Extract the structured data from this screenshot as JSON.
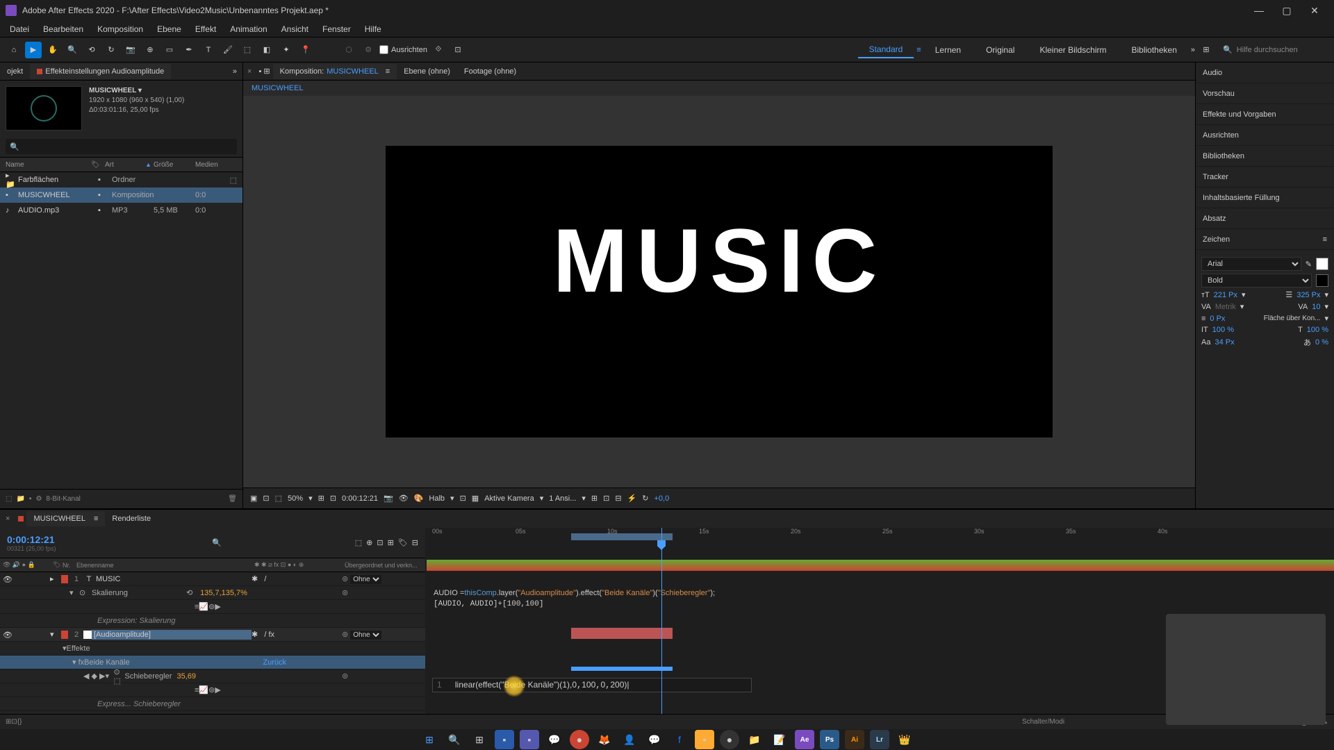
{
  "window": {
    "title": "Adobe After Effects 2020 - F:\\After Effects\\Video2Music\\Unbenanntes Projekt.aep *"
  },
  "menu": [
    "Datei",
    "Bearbeiten",
    "Komposition",
    "Ebene",
    "Effekt",
    "Animation",
    "Ansicht",
    "Fenster",
    "Hilfe"
  ],
  "toolbar": {
    "ausrichten": "Ausrichten",
    "workspaces": [
      "Standard",
      "Lernen",
      "Original",
      "Kleiner Bildschirm",
      "Bibliotheken"
    ],
    "search_placeholder": "Hilfe durchsuchen"
  },
  "project_panel": {
    "tab_projekt": "ojekt",
    "tab_effekt": "Effekteinstellungen Audioamplitude",
    "comp_name": "MUSICWHEEL ▾",
    "resolution": "1920 x 1080 (960 x 540) (1,00)",
    "duration": "Δ0:03:01:16, 25,00 fps",
    "cols": {
      "name": "Name",
      "art": "Art",
      "groesse": "Größe",
      "medien": "Medien"
    },
    "items": [
      {
        "icon": "▸ 📁",
        "name": "Farbflächen",
        "art": "Ordner",
        "size": "",
        "extra": ""
      },
      {
        "icon": "▪",
        "name": "MUSICWHEEL",
        "art": "Komposition",
        "size": "",
        "extra": "0:0",
        "selected": true
      },
      {
        "icon": "♪",
        "name": "AUDIO.mp3",
        "art": "MP3",
        "size": "5,5 MB",
        "extra": "0:0"
      }
    ],
    "footer": "8-Bit-Kanal"
  },
  "composition": {
    "tab_label": "Komposition:",
    "tab_name": "MUSICWHEEL",
    "tab_ebene": "Ebene (ohne)",
    "tab_footage": "Footage (ohne)",
    "crumb": "MUSICWHEEL",
    "content_text": "MUSIC",
    "zoom": "50%",
    "timecode": "0:00:12:21",
    "res": "Halb",
    "camera": "Aktive Kamera",
    "views": "1 Ansi...",
    "exposure": "+0,0"
  },
  "right_panels": [
    "Audio",
    "Vorschau",
    "Effekte und Vorgaben",
    "Ausrichten",
    "Bibliotheken",
    "Tracker",
    "Inhaltsbasierte Füllung",
    "Absatz",
    "Zeichen"
  ],
  "character": {
    "font": "Arial",
    "weight": "Bold",
    "size": "221 Px",
    "leading": "325 Px",
    "kerning": "Metrik",
    "tracking": "10",
    "stroke": "0 Px",
    "stroke_mode": "Fläche über Kon...",
    "vscale": "100 %",
    "hscale": "100 %",
    "baseline": "34 Px",
    "tsume": "0 %"
  },
  "timeline": {
    "tab": "MUSICWHEEL",
    "tab2": "Renderliste",
    "timecode": "0:00:12:21",
    "timecode_sub": "00321 (25,00 fps)",
    "col_nr": "Nr.",
    "col_name": "Ebenenname",
    "col_parent": "Übergeordnet und verkn...",
    "parent_none": "Ohne",
    "ticks": [
      "00s",
      "05s",
      "10s",
      "15s",
      "20s",
      "25s",
      "30s",
      "35s",
      "40s"
    ],
    "layers": {
      "l1_num": "1",
      "l1_name": "MUSIC",
      "l1_scale": "Skalierung",
      "l1_scale_val": "135,7,135,7%",
      "l1_expr_label": "Expression: Skalierung",
      "l2_num": "2",
      "l2_name": "[Audioamplitude]",
      "l2_effekte": "Effekte",
      "l2_both": "Beide Kanäle",
      "l2_zuruck": "Zurück",
      "l2_slider": "Schieberegler",
      "l2_slider_val": "35,69",
      "l2_expr_label": "Express... Schieberegler"
    },
    "expr1": {
      "prefix": "AUDIO =",
      "this": "thisComp",
      "layer": ".layer(",
      "layer_str": "\"Audioamplitude\"",
      "effect": ").effect(",
      "effect_str": "\"Beide Kanäle\"",
      "slider": ")(",
      "slider_str": "\"Schieberegler\"",
      "end": ");",
      "line2": "[AUDIO, AUDIO]+[100,100]"
    },
    "expr2": {
      "line_num": "1",
      "fn": "linear",
      "open": "(",
      "eff": "effect",
      "open2": "(",
      "str": "\"Beide Kanäle\"",
      "close": ")(",
      "n1": "1",
      "sep": "),",
      "n2": "0",
      "n3": "100",
      "n4": "0",
      "n5": "200",
      "close2": ")|"
    },
    "footer": "Schalter/Modi"
  }
}
